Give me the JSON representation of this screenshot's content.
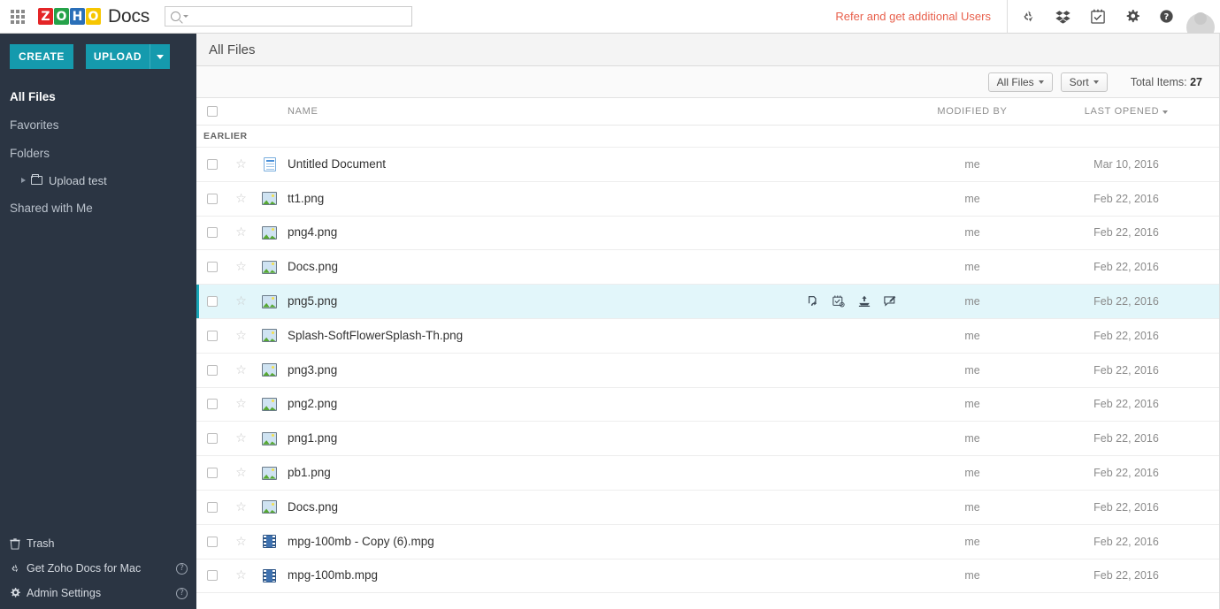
{
  "header": {
    "app_launcher": "apps-grid-icon",
    "brand_tiles": [
      "Z",
      "O",
      "H",
      "O"
    ],
    "brand_name": "Docs",
    "brand_colors": {
      "z": "#e42527",
      "o1": "#25a249",
      "h": "#2a6fb8",
      "o2": "#f7c600"
    },
    "search": {
      "value": "",
      "placeholder": ""
    },
    "refer_link": "Refer and get additional Users",
    "refer_color": "#e8604c",
    "icons": [
      {
        "name": "sync-icon",
        "title": "Sync"
      },
      {
        "name": "dropbox-icon",
        "title": "Dropbox"
      },
      {
        "name": "tasks-icon",
        "title": "Tasks"
      },
      {
        "name": "gear-icon",
        "title": "Settings"
      },
      {
        "name": "help-icon",
        "title": "Help"
      }
    ],
    "avatar": "user-avatar"
  },
  "sidebar": {
    "background": "#2b3543",
    "accent": "#159aad",
    "create_label": "CREATE",
    "upload_label": "UPLOAD",
    "items": [
      {
        "label": "All Files",
        "active": true
      },
      {
        "label": "Favorites",
        "active": false
      },
      {
        "label": "Folders",
        "active": false
      }
    ],
    "folder_child": "Upload test",
    "shared_label": "Shared with Me",
    "bottom_items": [
      {
        "label": "Trash",
        "icon": "trash-icon",
        "help": false
      },
      {
        "label": "Get Zoho Docs for Mac",
        "icon": "sync-icon",
        "help": true
      },
      {
        "label": "Admin Settings",
        "icon": "gear-icon",
        "help": true
      }
    ],
    "help_glyph": "?"
  },
  "main": {
    "page_title": "All Files",
    "toolbar": {
      "filter_label": "All Files",
      "sort_label": "Sort",
      "total_label": "Total Items:",
      "total_value": "27"
    },
    "columns": {
      "name": "NAME",
      "modified_by": "MODIFIED BY",
      "last_opened": "LAST OPENED"
    },
    "group_header": "EARLIER",
    "selected_row_accent": "#18a5b6",
    "selected_row_bg": "#e2f6fa",
    "row_actions": [
      {
        "name": "share-icon"
      },
      {
        "name": "task-icon"
      },
      {
        "name": "publish-icon"
      },
      {
        "name": "comment-icon"
      }
    ],
    "rows": [
      {
        "name": "Untitled Document",
        "icon": "document-icon",
        "type": "doc",
        "modified_by": "me",
        "last_opened": "Mar 10, 2016",
        "selected": false
      },
      {
        "name": "tt1.png",
        "icon": "image-icon",
        "type": "img",
        "modified_by": "me",
        "last_opened": "Feb 22, 2016",
        "selected": false
      },
      {
        "name": "png4.png",
        "icon": "image-icon",
        "type": "img",
        "modified_by": "me",
        "last_opened": "Feb 22, 2016",
        "selected": false
      },
      {
        "name": "Docs.png",
        "icon": "image-icon",
        "type": "img",
        "modified_by": "me",
        "last_opened": "Feb 22, 2016",
        "selected": false
      },
      {
        "name": "png5.png",
        "icon": "image-icon",
        "type": "img",
        "modified_by": "me",
        "last_opened": "Feb 22, 2016",
        "selected": true
      },
      {
        "name": "Splash-SoftFlowerSplash-Th.png",
        "icon": "image-icon",
        "type": "img",
        "modified_by": "me",
        "last_opened": "Feb 22, 2016",
        "selected": false
      },
      {
        "name": "png3.png",
        "icon": "image-icon",
        "type": "img",
        "modified_by": "me",
        "last_opened": "Feb 22, 2016",
        "selected": false
      },
      {
        "name": "png2.png",
        "icon": "image-icon",
        "type": "img",
        "modified_by": "me",
        "last_opened": "Feb 22, 2016",
        "selected": false
      },
      {
        "name": "png1.png",
        "icon": "image-icon",
        "type": "img",
        "modified_by": "me",
        "last_opened": "Feb 22, 2016",
        "selected": false
      },
      {
        "name": "pb1.png",
        "icon": "image-icon",
        "type": "img",
        "modified_by": "me",
        "last_opened": "Feb 22, 2016",
        "selected": false
      },
      {
        "name": "Docs.png",
        "icon": "image-icon",
        "type": "img",
        "modified_by": "me",
        "last_opened": "Feb 22, 2016",
        "selected": false
      },
      {
        "name": "mpg-100mb - Copy (6).mpg",
        "icon": "video-icon",
        "type": "vid",
        "modified_by": "me",
        "last_opened": "Feb 22, 2016",
        "selected": false
      },
      {
        "name": "mpg-100mb.mpg",
        "icon": "video-icon",
        "type": "vid",
        "modified_by": "me",
        "last_opened": "Feb 22, 2016",
        "selected": false
      }
    ]
  }
}
